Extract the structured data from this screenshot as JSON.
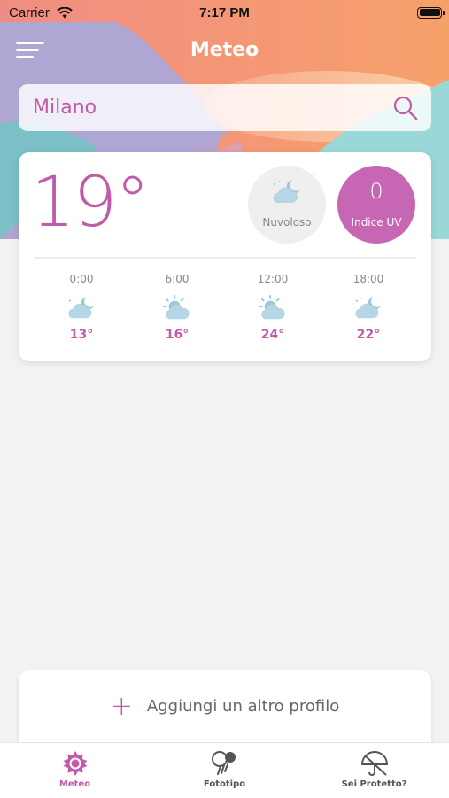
{
  "status_bar": {
    "carrier": "Carrier",
    "time": "7:17 PM"
  },
  "header": {
    "title": "Meteo"
  },
  "search": {
    "value": "Milano",
    "placeholder": ""
  },
  "current": {
    "temperature": "19°",
    "condition": {
      "label": "Nuvoloso",
      "icon": "partly-cloudy-night-icon"
    },
    "uv": {
      "value": "0",
      "label": "Indice UV"
    }
  },
  "hourly": [
    {
      "time": "0:00",
      "temp": "13°",
      "icon": "partly-cloudy-night-icon"
    },
    {
      "time": "6:00",
      "temp": "16°",
      "icon": "partly-sunny-icon"
    },
    {
      "time": "12:00",
      "temp": "24°",
      "icon": "partly-sunny-icon"
    },
    {
      "time": "18:00",
      "temp": "22°",
      "icon": "partly-cloudy-night-icon"
    }
  ],
  "add_profile": {
    "label": "Aggiungi un altro profilo",
    "icon": "plus-icon"
  },
  "tabs": [
    {
      "label": "Meteo",
      "icon": "sun-icon",
      "active": true
    },
    {
      "label": "Fototipo",
      "icon": "phototype-icon",
      "active": false
    },
    {
      "label": "Sei Protetto?",
      "icon": "umbrella-icon",
      "active": false
    }
  ],
  "colors": {
    "accent": "#c15aa8",
    "uv_circle": "#c766b3",
    "icon_blue": "#a9cfdf"
  }
}
